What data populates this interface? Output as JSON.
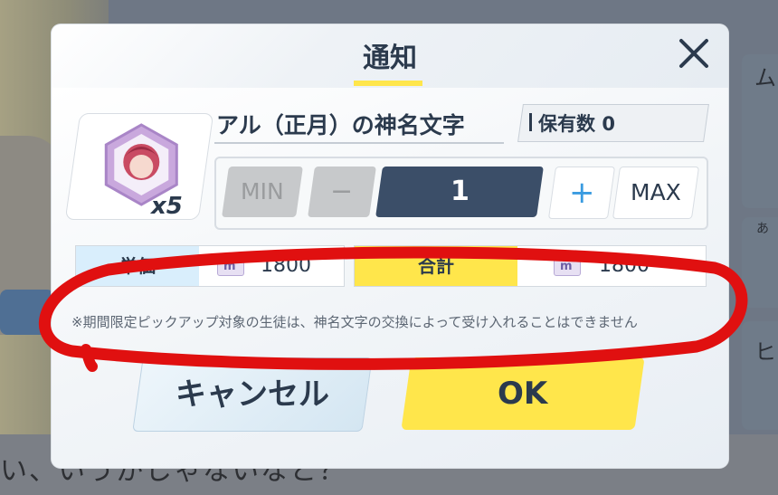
{
  "background": {
    "dialogue_text": "い、いうかしゃないなと？",
    "side_texts": [
      "ム",
      "あ",
      "ヒ"
    ]
  },
  "modal": {
    "title": "通知",
    "close_icon": "close-icon",
    "item": {
      "name": "アル（正月）の神名文字",
      "icon": "hexagon-character-icon",
      "quantity_badge": "x5",
      "owned_label": "保有数",
      "owned_count": "0"
    },
    "stepper": {
      "min_label": "MIN",
      "minus_label": "−",
      "value": "1",
      "plus_label": "+",
      "max_label": "MAX"
    },
    "price": {
      "unit_label": "単価",
      "unit_value": "1800",
      "total_label": "合計",
      "total_value": "1800",
      "currency_icon": "eligma-icon"
    },
    "notice": "※期間限定ピックアップ対象の生徒は、神名文字の交換によって受け入れることはできません",
    "buttons": {
      "cancel": "キャンセル",
      "ok": "OK"
    }
  },
  "colors": {
    "accent_yellow": "#ffe64b",
    "dark_navy": "#3b4e68",
    "annotation_red": "#e01010"
  }
}
